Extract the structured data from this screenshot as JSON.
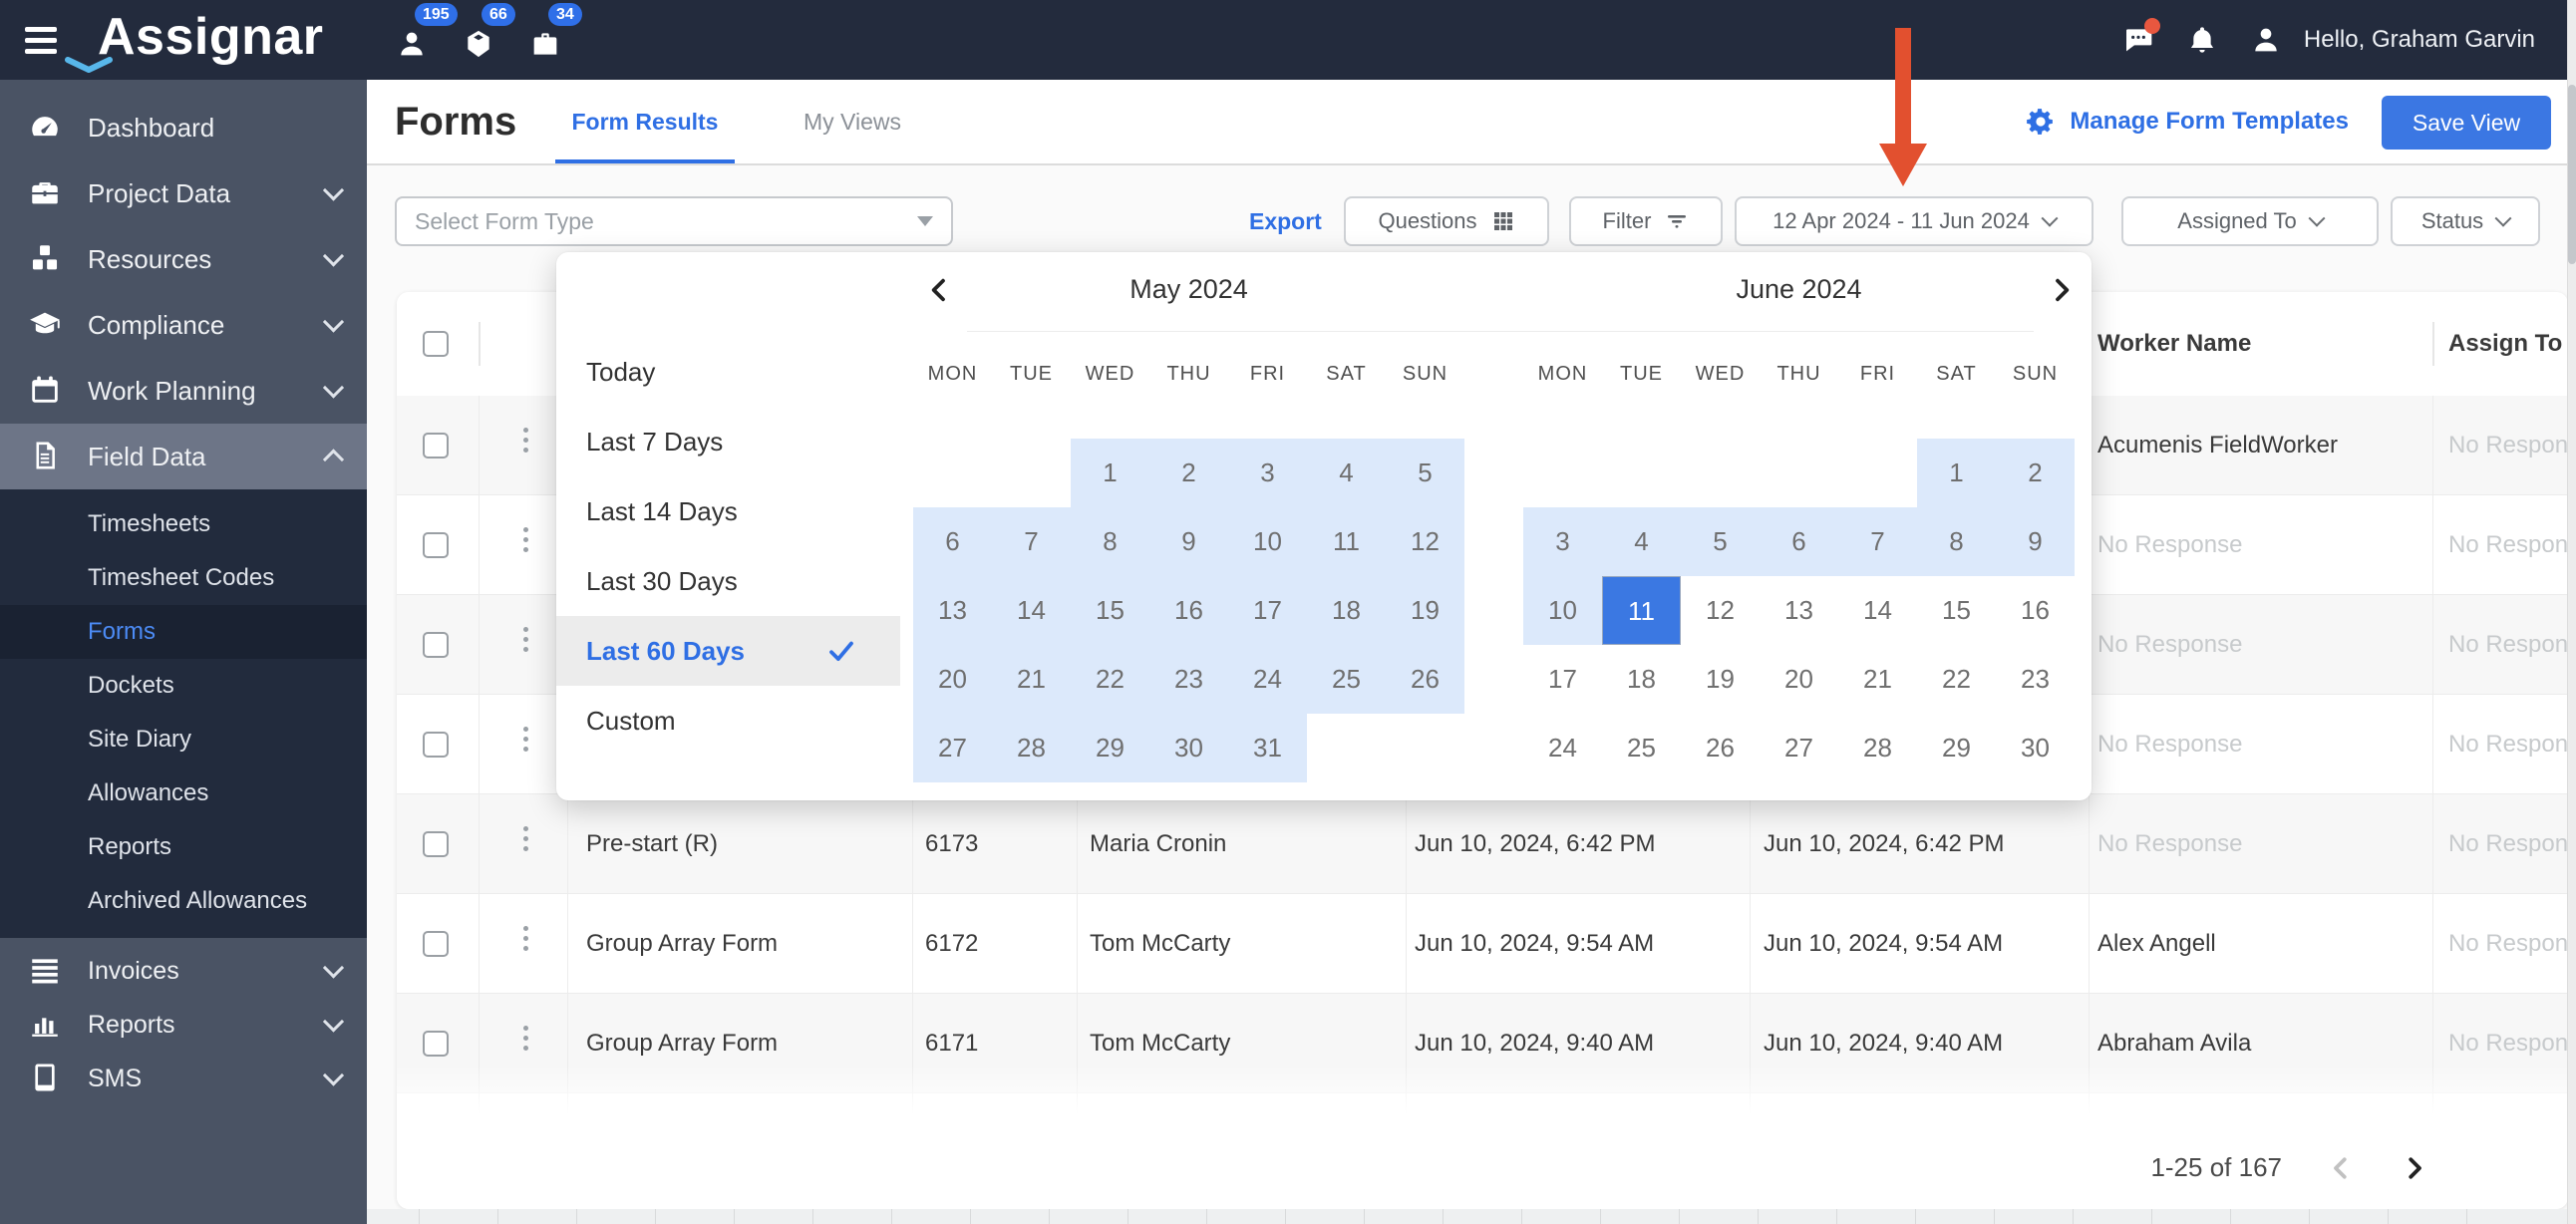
{
  "topbar": {
    "brand": "Assignar",
    "badges": [
      {
        "icon": "person-icon",
        "count": "195"
      },
      {
        "icon": "cube-icon",
        "count": "66"
      },
      {
        "icon": "briefcase-icon",
        "count": "34"
      }
    ],
    "greeting": "Hello, Graham Garvin"
  },
  "sidebar": {
    "main": [
      {
        "label": "Dashboard",
        "icon": "dashboard",
        "chevron": null,
        "active": false
      },
      {
        "label": "Project Data",
        "icon": "toolbox",
        "chevron": "down",
        "active": false
      },
      {
        "label": "Resources",
        "icon": "cubes",
        "chevron": "down",
        "active": false
      },
      {
        "label": "Compliance",
        "icon": "gradcap",
        "chevron": "down",
        "active": false
      },
      {
        "label": "Work Planning",
        "icon": "calendar",
        "chevron": "down",
        "active": false
      },
      {
        "label": "Field Data",
        "icon": "document",
        "chevron": "up",
        "active": true
      }
    ],
    "sub": [
      {
        "label": "Timesheets",
        "active": false
      },
      {
        "label": "Timesheet Codes",
        "active": false
      },
      {
        "label": "Forms",
        "active": true
      },
      {
        "label": "Dockets",
        "active": false
      },
      {
        "label": "Site Diary",
        "active": false
      },
      {
        "label": "Allowances",
        "active": false
      },
      {
        "label": "Reports",
        "active": false
      },
      {
        "label": "Archived Allowances",
        "active": false
      }
    ],
    "bottom": [
      {
        "label": "Invoices",
        "icon": "list",
        "chevron": "down",
        "active": false
      },
      {
        "label": "Reports",
        "icon": "barchart",
        "chevron": "down",
        "active": false
      },
      {
        "label": "SMS",
        "icon": "phone",
        "chevron": "down",
        "active": false
      }
    ]
  },
  "header": {
    "title": "Forms",
    "tabs": [
      {
        "label": "Form Results",
        "active": true
      },
      {
        "label": "My Views",
        "active": false
      }
    ],
    "manage_label": "Manage Form Templates",
    "save_label": "Save View"
  },
  "filters": {
    "form_type_placeholder": "Select Form Type",
    "export_label": "Export",
    "questions_label": "Questions",
    "filter_label": "Filter",
    "date_range_value": "12 Apr 2024 - 11 Jun 2024",
    "assigned_to_label": "Assigned To",
    "status_label": "Status"
  },
  "datepicker": {
    "presets": [
      {
        "label": "Today",
        "selected": false
      },
      {
        "label": "Last 7 Days",
        "selected": false
      },
      {
        "label": "Last 14 Days",
        "selected": false
      },
      {
        "label": "Last 30 Days",
        "selected": false
      },
      {
        "label": "Last 60 Days",
        "selected": true
      },
      {
        "label": "Custom",
        "selected": false
      }
    ],
    "months": [
      {
        "title": "May 2024",
        "weekdays": [
          "MON",
          "TUE",
          "WED",
          "THU",
          "FRI",
          "SAT",
          "SUN"
        ],
        "weeks": [
          [
            null,
            null,
            {
              "d": 1,
              "s": "r"
            },
            {
              "d": 2,
              "s": "r"
            },
            {
              "d": 3,
              "s": "r"
            },
            {
              "d": 4,
              "s": "r"
            },
            {
              "d": 5,
              "s": "r"
            }
          ],
          [
            {
              "d": 6,
              "s": "r"
            },
            {
              "d": 7,
              "s": "r"
            },
            {
              "d": 8,
              "s": "r"
            },
            {
              "d": 9,
              "s": "r"
            },
            {
              "d": 10,
              "s": "r"
            },
            {
              "d": 11,
              "s": "r"
            },
            {
              "d": 12,
              "s": "r"
            }
          ],
          [
            {
              "d": 13,
              "s": "r"
            },
            {
              "d": 14,
              "s": "r"
            },
            {
              "d": 15,
              "s": "r"
            },
            {
              "d": 16,
              "s": "r"
            },
            {
              "d": 17,
              "s": "r"
            },
            {
              "d": 18,
              "s": "r"
            },
            {
              "d": 19,
              "s": "r"
            }
          ],
          [
            {
              "d": 20,
              "s": "r"
            },
            {
              "d": 21,
              "s": "r"
            },
            {
              "d": 22,
              "s": "r"
            },
            {
              "d": 23,
              "s": "r"
            },
            {
              "d": 24,
              "s": "r"
            },
            {
              "d": 25,
              "s": "r"
            },
            {
              "d": 26,
              "s": "r"
            }
          ],
          [
            {
              "d": 27,
              "s": "r"
            },
            {
              "d": 28,
              "s": "r"
            },
            {
              "d": 29,
              "s": "r"
            },
            {
              "d": 30,
              "s": "r"
            },
            {
              "d": 31,
              "s": "r"
            },
            null,
            null
          ]
        ]
      },
      {
        "title": "June 2024",
        "weekdays": [
          "MON",
          "TUE",
          "WED",
          "THU",
          "FRI",
          "SAT",
          "SUN"
        ],
        "weeks": [
          [
            null,
            null,
            null,
            null,
            null,
            {
              "d": 1,
              "s": "r"
            },
            {
              "d": 2,
              "s": "r"
            }
          ],
          [
            {
              "d": 3,
              "s": "r"
            },
            {
              "d": 4,
              "s": "r"
            },
            {
              "d": 5,
              "s": "r"
            },
            {
              "d": 6,
              "s": "r"
            },
            {
              "d": 7,
              "s": "r"
            },
            {
              "d": 8,
              "s": "r"
            },
            {
              "d": 9,
              "s": "r"
            }
          ],
          [
            {
              "d": 10,
              "s": "r"
            },
            {
              "d": 11,
              "s": "sel"
            },
            {
              "d": 12,
              "s": "p"
            },
            {
              "d": 13,
              "s": "p"
            },
            {
              "d": 14,
              "s": "p"
            },
            {
              "d": 15,
              "s": "p"
            },
            {
              "d": 16,
              "s": "p"
            }
          ],
          [
            {
              "d": 17,
              "s": "p"
            },
            {
              "d": 18,
              "s": "p"
            },
            {
              "d": 19,
              "s": "p"
            },
            {
              "d": 20,
              "s": "p"
            },
            {
              "d": 21,
              "s": "p"
            },
            {
              "d": 22,
              "s": "p"
            },
            {
              "d": 23,
              "s": "p"
            }
          ],
          [
            {
              "d": 24,
              "s": "p"
            },
            {
              "d": 25,
              "s": "p"
            },
            {
              "d": 26,
              "s": "p"
            },
            {
              "d": 27,
              "s": "p"
            },
            {
              "d": 28,
              "s": "p"
            },
            {
              "d": 29,
              "s": "p"
            },
            {
              "d": 30,
              "s": "p"
            }
          ]
        ]
      }
    ]
  },
  "table": {
    "headers": {
      "worker": "Worker Name",
      "assign": "Assign To"
    },
    "rows": [
      {
        "form": "",
        "id": "",
        "created_by": "",
        "submitted": "",
        "completed": "",
        "worker": "Acumenis FieldWorker",
        "assign": "No Response",
        "partial": false
      },
      {
        "form": "",
        "id": "",
        "created_by": "",
        "submitted": "",
        "completed": "",
        "worker": "No Response",
        "assign": "No Response",
        "partial": false
      },
      {
        "form": "",
        "id": "",
        "created_by": "",
        "submitted": "",
        "completed": "",
        "worker": "No Response",
        "assign": "No Response",
        "partial": false
      },
      {
        "form": "",
        "id": "",
        "created_by": "",
        "submitted": "",
        "completed": "",
        "worker": "No Response",
        "assign": "No Response",
        "partial": false
      },
      {
        "form": "Pre-start (R)",
        "id": "6173",
        "created_by": "Maria Cronin",
        "submitted": "Jun 10, 2024, 6:42 PM",
        "completed": "Jun 10, 2024, 6:42 PM",
        "worker": "No Response",
        "assign": "No Response",
        "partial": false
      },
      {
        "form": "Group Array Form",
        "id": "6172",
        "created_by": "Tom McCarty",
        "submitted": "Jun 10, 2024, 9:54 AM",
        "completed": "Jun 10, 2024, 9:54 AM",
        "worker": "Alex Angell",
        "assign": "No Response",
        "partial": false
      },
      {
        "form": "Group Array Form",
        "id": "6171",
        "created_by": "Tom McCarty",
        "submitted": "Jun 10, 2024, 9:40 AM",
        "completed": "Jun 10, 2024, 9:40 AM",
        "worker": "Abraham Avila",
        "assign": "No Response",
        "partial": false
      },
      {
        "form": "",
        "id": "",
        "created_by": "",
        "submitted": "",
        "completed": "",
        "worker": "",
        "assign": "",
        "partial": true
      }
    ]
  },
  "pagination": {
    "range_label": "1-25 of 167"
  },
  "colors": {
    "topbar_bg": "#232B3D",
    "sidebar_bg": "#4A5364",
    "sidebar_active_bg": "#6D7587",
    "submenu_bg": "#222B3D",
    "submenu_active_bg": "#1A2232",
    "accent_blue": "#2F6FE4",
    "save_button_bg": "#3B77E3",
    "range_highlight": "#DCE9FB",
    "selected_day_bg": "#3B78E2",
    "badge_bg": "#2F6FE8",
    "annotation_arrow": "#E2502F",
    "muted_text": "#C7CACC"
  }
}
